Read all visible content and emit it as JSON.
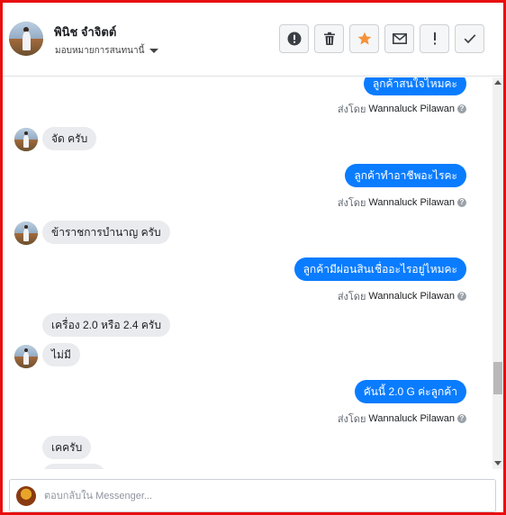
{
  "header": {
    "contact_name": "พินิช จําจิตต์",
    "assign_label": "มอบหมายการสนทนานี้"
  },
  "toolbar": {
    "buttons": [
      {
        "name": "spam-button",
        "icon": "alert-circle-icon"
      },
      {
        "name": "delete-button",
        "icon": "trash-icon"
      },
      {
        "name": "star-button",
        "icon": "star-icon",
        "color": "#f7923b"
      },
      {
        "name": "mark-unread-button",
        "icon": "envelope-icon"
      },
      {
        "name": "follow-up-button",
        "icon": "exclamation-icon"
      },
      {
        "name": "done-button",
        "icon": "checkmark-icon"
      }
    ]
  },
  "thread": {
    "sent_by_prefix": "ส่งโดย",
    "agent_name": "Wannaluck Pilawan",
    "messages": [
      {
        "dir": "out",
        "text": "ลูกค้าสนใจไหมคะ"
      },
      {
        "dir": "in",
        "text": "จัด ครับ"
      },
      {
        "dir": "out",
        "text": "ลูกค้าทำอาชีพอะไรคะ"
      },
      {
        "dir": "in",
        "text": "ข้าราชการบำนาญ ครับ"
      },
      {
        "dir": "out",
        "text": "ลูกค้ามีผ่อนสินเชื่ออะไรอยู่ไหมคะ"
      },
      {
        "dir": "in",
        "text": "เครื่อง 2.0 หรือ 2.4  ครับ"
      },
      {
        "dir": "in",
        "text": "ไม่มี"
      },
      {
        "dir": "out",
        "text": "คันนี้ 2.0  G ค่ะลูกค้า"
      },
      {
        "dir": "in",
        "text": "เคครับ"
      }
    ]
  },
  "composer": {
    "placeholder": "ตอบกลับใน Messenger..."
  },
  "colors": {
    "frame": "#e80d0d",
    "outgoing_bubble": "#0a7cff",
    "incoming_bubble": "#e9ebee",
    "star": "#f7923b"
  }
}
